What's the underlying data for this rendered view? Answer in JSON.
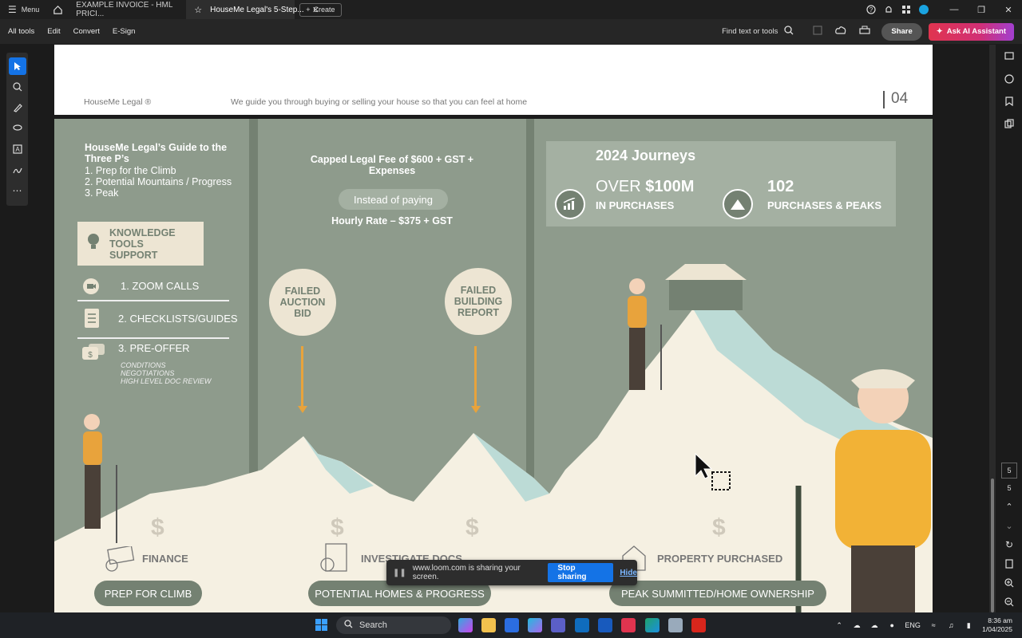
{
  "titlebar": {
    "menu_label": "Menu",
    "tabs": [
      {
        "label": "EXAMPLE INVOICE - HML PRICI..."
      },
      {
        "label": "HouseMe Legal's 5-Step..."
      }
    ],
    "create_label": "Create"
  },
  "toolbar": {
    "items": [
      "All tools",
      "Edit",
      "Convert",
      "E-Sign"
    ],
    "find_label": "Find text or tools",
    "share_label": "Share",
    "ai_label": "Ask AI Assistant"
  },
  "page_header": {
    "brand": "HouseMe Legal ®",
    "tagline": "We guide you through buying or selling your house so that you can feel at home",
    "page_number": "04"
  },
  "slide": {
    "guide_title": "HouseMe Legal’s Guide to the Three P’s",
    "guide_items": [
      "1. Prep for the Climb",
      "2. Potential Mountains / Progress",
      "3. Peak"
    ],
    "knowledge_box": [
      "KNOWLEDGE",
      "TOOLS",
      "SUPPORT"
    ],
    "list": [
      "1. ZOOM CALLS",
      "2. CHECKLISTS/GUIDES",
      "3. PRE-OFFER"
    ],
    "preoffer_sub": [
      "CONDITIONS",
      "NEGOTIATIONS",
      "HIGH LEVEL DOC REVIEW"
    ],
    "fee_title": "Capped Legal Fee of $600 + GST + Expenses",
    "instead_label": "Instead of paying",
    "hourly_label": "Hourly Rate – $375 + GST",
    "failed1": "FAILED AUCTION BID",
    "failed2": "FAILED BUILDING REPORT",
    "journeys_title": "2024 Journeys",
    "stat1_over": "OVER",
    "stat1_value": "$100M",
    "stat1_label": "IN PURCHASES",
    "stat2_value": "102",
    "stat2_label": "PURCHASES & PEAKS",
    "dollar_sign": "$",
    "finance_label": "FINANCE",
    "investigate_label": "INVESTIGATE DOCS",
    "property_label": "PROPERTY PURCHASED",
    "pill1": "PREP FOR CLIMB",
    "pill2": "POTENTIAL HOMES & PROGRESS",
    "pill3": "PEAK SUMMITTED/HOME OWNERSHIP"
  },
  "loom_bar": {
    "message": "www.loom.com is sharing your screen.",
    "stop_label": "Stop sharing",
    "hide_label": "Hide"
  },
  "right_rail": {
    "page_current": "5",
    "page_total": "5"
  },
  "taskbar": {
    "search_label": "Search",
    "lang": "ENG",
    "time": "8:36 am",
    "date": "1/04/2025"
  }
}
